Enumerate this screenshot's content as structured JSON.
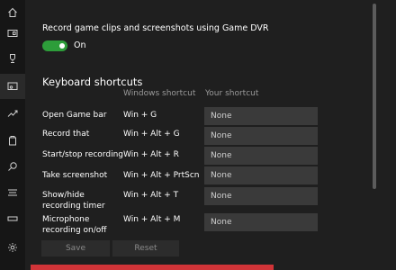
{
  "nav": {
    "items": [
      {
        "icon": "home-icon"
      },
      {
        "icon": "game-bar-icon"
      },
      {
        "icon": "trophy-icon"
      },
      {
        "icon": "game-dvr-icon"
      },
      {
        "icon": "trending-icon"
      },
      {
        "icon": "game-mode-icon"
      },
      {
        "icon": "search-icon"
      },
      {
        "icon": "network-icon"
      },
      {
        "icon": "xbox-networking-icon"
      },
      {
        "icon": "settings-icon"
      }
    ]
  },
  "dvr": {
    "label": "Record game clips and screenshots using Game DVR",
    "toggle_state": "On",
    "toggle_color": "#2d9d3a"
  },
  "shortcuts": {
    "title": "Keyboard shortcuts",
    "col_windows": "Windows shortcut",
    "col_yours": "Your shortcut",
    "rows": [
      {
        "label": "Open Game bar",
        "windows": "Win + G",
        "yours": "None"
      },
      {
        "label": "Record that",
        "windows": "Win + Alt + G",
        "yours": "None"
      },
      {
        "label": "Start/stop recording",
        "windows": "Win + Alt + R",
        "yours": "None"
      },
      {
        "label": "Take screenshot",
        "windows": "Win + Alt + PrtScn",
        "yours": "None"
      },
      {
        "label": "Show/hide recording timer",
        "windows": "Win + Alt + T",
        "yours": "None"
      },
      {
        "label": "Microphone recording on/off",
        "windows": "Win + Alt + M",
        "yours": "None"
      }
    ]
  },
  "buttons": {
    "save": "Save",
    "reset": "Reset"
  },
  "colors": {
    "accent_bar": "#d13438"
  }
}
